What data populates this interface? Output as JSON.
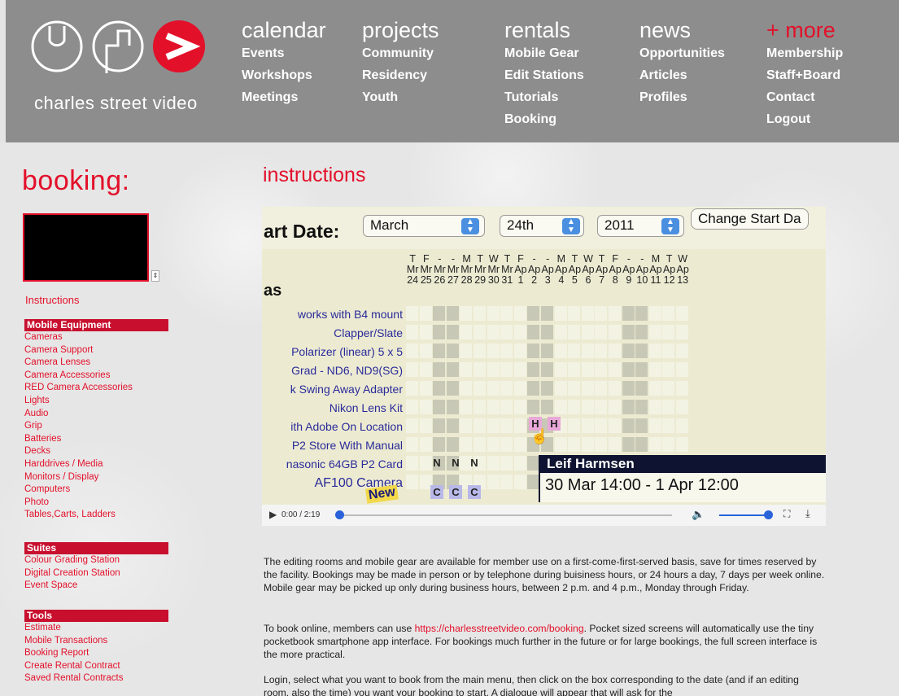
{
  "brand": {
    "logo_text": "charles street video",
    "logo_colors": {
      "ring": "#ffffff",
      "accent": "#e3102a",
      "header_bg": "#8d8d8d"
    }
  },
  "nav": [
    {
      "head": "calendar",
      "items": [
        "Events",
        "Workshops",
        "Meetings"
      ]
    },
    {
      "head": "projects",
      "items": [
        "Community",
        "Residency",
        "Youth"
      ]
    },
    {
      "head": "rentals",
      "items": [
        "Mobile Gear",
        "Edit Stations",
        "Tutorials",
        "Booking"
      ]
    },
    {
      "head": "news",
      "items": [
        "Opportunities",
        "Articles",
        "Profiles"
      ]
    },
    {
      "head": "+ more",
      "items": [
        "Membership",
        "Staff+Board",
        "Contact",
        "Logout"
      ]
    }
  ],
  "sidebar": {
    "title": "booking:",
    "top_link": "Instructions",
    "sections": [
      {
        "head": "Mobile Equipment",
        "items": [
          "Cameras",
          "Camera Support",
          "Camera Lenses",
          "Camera Accessories",
          "RED Camera Accessories",
          "Lights",
          "Audio",
          "Grip",
          "Batteries",
          "Decks",
          "Harddrives / Media",
          "Monitors / Display",
          "Computers",
          "Photo",
          "Tables,Carts, Ladders"
        ]
      },
      {
        "head": "Suites",
        "items": [
          "Colour Grading Station",
          "Digital Creation Station",
          "Event Space"
        ]
      },
      {
        "head": "Tools",
        "items": [
          "Estimate",
          "Mobile Transactions",
          "Booking Report",
          "Create Rental Contract",
          "Saved Rental Contracts"
        ]
      }
    ]
  },
  "main": {
    "title": "instructions",
    "video": {
      "start_label": "art Date:",
      "month": "March",
      "day": "24th",
      "year": "2011",
      "change_button": "Change Start Da",
      "list_heading": "as",
      "day_letters": [
        "T",
        "F",
        "-",
        "-",
        "M",
        "T",
        "W",
        "T",
        "F",
        "-",
        "-",
        "M",
        "T",
        "W",
        "T",
        "F",
        "-",
        "-",
        "M",
        "T",
        "W"
      ],
      "month_abbr": [
        "Mr",
        "Mr",
        "Mr",
        "Mr",
        "Mr",
        "Mr",
        "Mr",
        "Mr",
        "Ap",
        "Ap",
        "Ap",
        "Ap",
        "Ap",
        "Ap",
        "Ap",
        "Ap",
        "Ap",
        "Ap",
        "Ap",
        "Ap",
        "Ap"
      ],
      "day_numbers": [
        "24",
        "25",
        "26",
        "27",
        "28",
        "29",
        "30",
        "31",
        "1",
        "2",
        "3",
        "4",
        "5",
        "6",
        "7",
        "8",
        "9",
        "10",
        "11",
        "12",
        "13"
      ],
      "rows": [
        "works with B4 mount",
        "Clapper/Slate",
        "Polarizer (linear) 5 x 5",
        "Grad - ND6, ND9(SG)",
        "k Swing Away Adapter",
        "Nikon Lens Kit",
        "ith Adobe On Location",
        "P2 Store With Manual",
        "nasonic 64GB P2 Card",
        "AF100 Camera"
      ],
      "new_badge": "New",
      "bookings_h": [
        "H",
        "H"
      ],
      "bookings_n": [
        "N",
        "N",
        "N"
      ],
      "bookings_c": [
        "C",
        "C",
        "C"
      ],
      "tooltip_name": "Leif Harmsen",
      "tooltip_range": "30 Mar 14:00 - 1 Apr 12:00",
      "time": "0:00 / 2:19",
      "progress_fraction": 0.0,
      "volume_fraction": 1.0
    },
    "paragraphs": {
      "p1": "The editing rooms and mobile gear are available for member use on a first-come-first-served basis, save for times reserved by the facility. Bookings may be made in person or by telephone during buisiness hours,  or 24 hours a day, 7 days per week online. Mobile gear may be picked up only during business hours, between 2 p.m. and 4 p.m., Monday through Friday.",
      "p2_before": "To book online, members can use ",
      "p2_link": "https://charlesstreetvideo.com/booking",
      "p2_after": ". Pocket sized screens will automatically use the tiny pocketbook smartphone app interface. For bookings much further in the future or for large bookings, the full screen interface is the more practical.",
      "p3": "Login, select what you want to book from the main menu, then click on the box corresponding to the date (and if an editing room, also the time) you want your booking to start.  A dialogue will appear that will ask for the"
    }
  }
}
